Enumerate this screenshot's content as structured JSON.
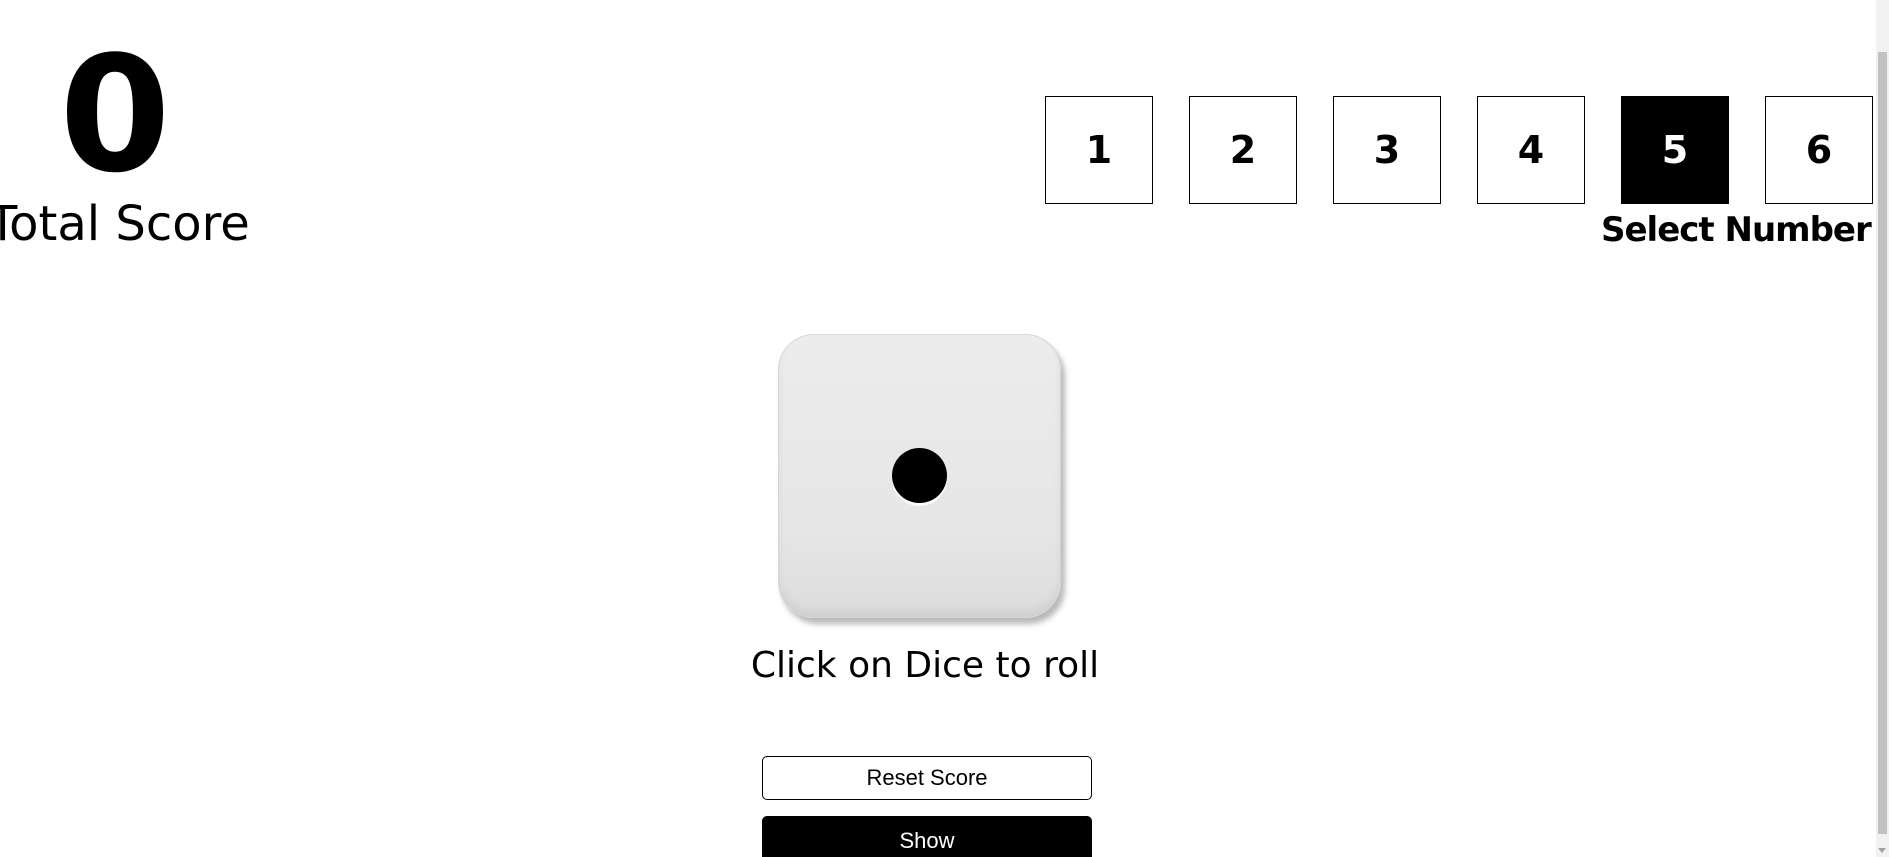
{
  "score": {
    "value": "0",
    "label": "Total Score"
  },
  "selector": {
    "numbers": [
      "1",
      "2",
      "3",
      "4",
      "5",
      "6"
    ],
    "selected": "5",
    "label": "Select Number"
  },
  "dice": {
    "face_value": 1,
    "hint": "Click on Dice to roll"
  },
  "buttons": {
    "reset_label": "Reset Score",
    "show_label": "Show"
  },
  "colors": {
    "primary": "#000000",
    "background": "#ffffff",
    "dice_face": "#e8e8e8"
  }
}
